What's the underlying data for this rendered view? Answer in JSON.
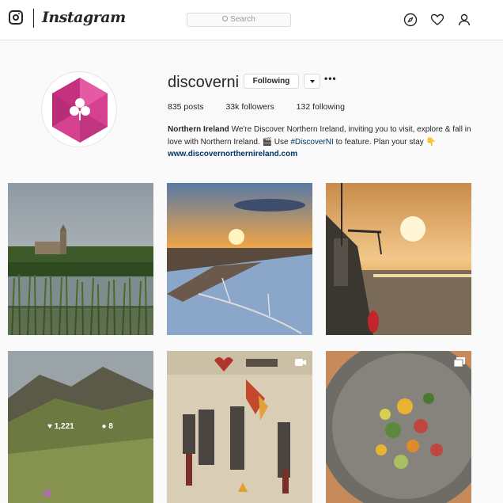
{
  "nav": {
    "wordmark": "Instagram",
    "search_placeholder": "Search",
    "icons": [
      "explore-compass-icon",
      "activity-heart-icon",
      "profile-person-icon"
    ]
  },
  "profile": {
    "username": "discoverni",
    "following_button": "Following",
    "more": "•••",
    "stats": {
      "posts": "835 posts",
      "followers": "33k followers",
      "following": "132 following"
    },
    "bio": {
      "name": "Northern Ireland",
      "text1": "We're Discover Northern Ireland, inviting you to visit, explore & fall in love with Northern Ireland.",
      "emoji1": "🎬",
      "text2": "Use",
      "hashtag": "#DiscoverNI",
      "text3": "to feature. Plan your stay",
      "emoji2": "👇",
      "website": "www.discovernorthernireland.com"
    }
  },
  "posts": [
    {
      "label": "post-cathedral-lake"
    },
    {
      "label": "post-sunset-bridge"
    },
    {
      "label": "post-boat-sunset"
    },
    {
      "label": "post-mountains",
      "likes": "1,221",
      "comments": "8"
    },
    {
      "label": "post-tapestry",
      "type": "video"
    },
    {
      "label": "post-food-plate",
      "type": "carousel"
    }
  ],
  "colors": {
    "accent_pink": "#d6418f",
    "link": "#003569"
  }
}
